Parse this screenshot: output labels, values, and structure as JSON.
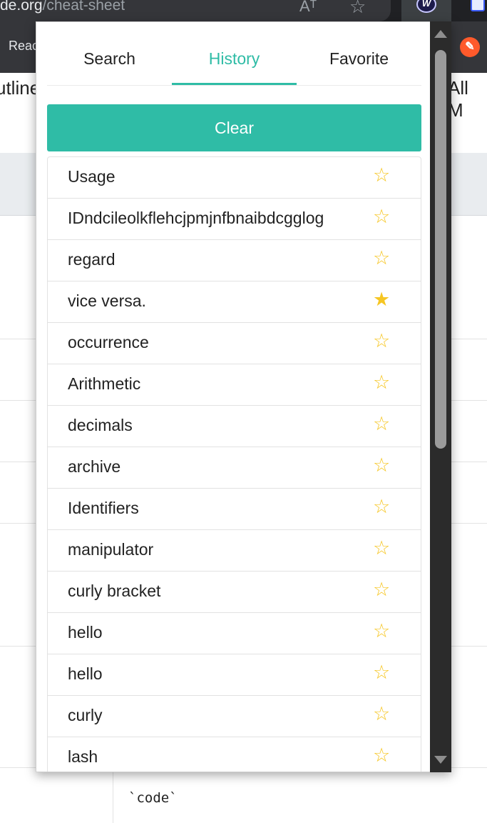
{
  "browser": {
    "url_host": "de.org",
    "url_path": "/cheat-sheet",
    "read_aloud_icon": "read-aloud-icon",
    "bookmark_icon": "star-outline-icon",
    "bookmark_bar_item": "Reac"
  },
  "page_background": {
    "heading_left": "utline",
    "heading_right": "All M",
    "code_sample": "`code`"
  },
  "popup": {
    "tabs": [
      {
        "label": "Search",
        "active": false
      },
      {
        "label": "History",
        "active": true
      },
      {
        "label": "Favorite",
        "active": false
      }
    ],
    "clear_label": "Clear",
    "accent_color": "#2fbca6",
    "star_color": "#f6c623",
    "history": [
      {
        "label": "Usage",
        "favorited": false
      },
      {
        "label": "IDndcileolkflehcjpmjnfbnaibdcgglog",
        "favorited": false
      },
      {
        "label": "regard",
        "favorited": false
      },
      {
        "label": "vice versa.",
        "favorited": true
      },
      {
        "label": "occurrence",
        "favorited": false
      },
      {
        "label": "Arithmetic",
        "favorited": false
      },
      {
        "label": "decimals",
        "favorited": false
      },
      {
        "label": "archive",
        "favorited": false
      },
      {
        "label": "Identifiers",
        "favorited": false
      },
      {
        "label": "manipulator",
        "favorited": false
      },
      {
        "label": "curly bracket",
        "favorited": false
      },
      {
        "label": "hello",
        "favorited": false
      },
      {
        "label": "hello",
        "favorited": false
      },
      {
        "label": "curly",
        "favorited": false
      },
      {
        "label": "lash",
        "favorited": false
      }
    ]
  }
}
